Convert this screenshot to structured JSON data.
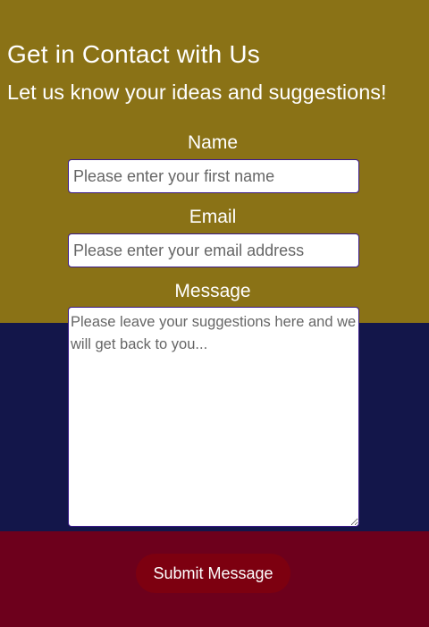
{
  "header": {
    "title": "Get in Contact with Us",
    "subtitle": "Let us know your ideas and suggestions!"
  },
  "form": {
    "name": {
      "label": "Name",
      "placeholder": "Please enter your first name",
      "value": ""
    },
    "email": {
      "label": "Email",
      "placeholder": "Please enter your email address",
      "value": ""
    },
    "message": {
      "label": "Message",
      "placeholder": "Please leave your suggestions here and we will get back to you...",
      "value": ""
    },
    "submit_label": "Submit Message"
  },
  "colors": {
    "top_band": "#8a7216",
    "middle_band": "#13164a",
    "bottom_band": "#6d001c",
    "button": "#7d0010",
    "input_border": "#3a1a8a",
    "text": "#ffffff"
  }
}
